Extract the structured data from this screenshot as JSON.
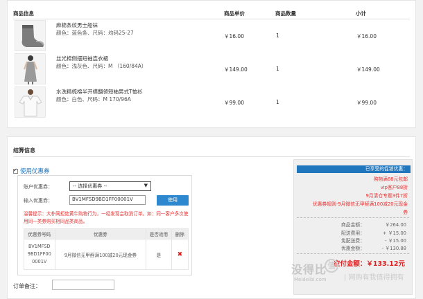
{
  "goods": {
    "headers": {
      "product": "商品信息",
      "price": "商品单价",
      "qty": "商品数量",
      "subtotal": "小计"
    },
    "items": [
      {
        "name": "麻棉条纹男士船袜",
        "attrs": "颜色：蓝色条、尺码：均码25-27",
        "price": "￥16.00",
        "qty": "1",
        "subtotal": "￥16.00",
        "image": "socks-image"
      },
      {
        "name": "丝光棉侧摆短袖连衣裙",
        "attrs": "颜色：浅灰色、尺码：M （160/84A）",
        "price": "￥149.00",
        "qty": "1",
        "subtotal": "￥149.00",
        "image": "dress-image"
      },
      {
        "name": "水洗精梳棉半开襟翻领短袖男式T恤衫",
        "attrs": "颜色：白色、尺码：M 170/96A",
        "price": "￥99.00",
        "qty": "1",
        "subtotal": "￥99.00",
        "image": "tshirt-image"
      }
    ]
  },
  "settle": {
    "title": "结算信息",
    "use_coupon": "使用优惠券",
    "account_coupon_label": "账户优惠券：",
    "account_coupon_value": "-- 选择优惠券 --",
    "input_coupon_label": "输入优惠券：",
    "input_coupon_value": "BV1MFSD9BD1FF00001V",
    "use_button": "使用",
    "tip": "温馨提示：大朴网拒绝黄牛购物行为，一经发现会取消订单。如：同一客户多次使用同一类券购买相同品类商品。",
    "table_headers": {
      "code": "优惠券号码",
      "coupon": "优惠券",
      "applied": "是否适用",
      "delete": "删除"
    },
    "row": {
      "code_lines": [
        "BV1MFSD",
        "9BD1FF00",
        "0001V"
      ],
      "coupon": "9月微信无甲醛满100减20元现金券",
      "applied": "是"
    },
    "remark_label": "订单备注："
  },
  "summary": {
    "promo_header": "已享受的促销优惠：",
    "promos": [
      "购物满88元包邮",
      "vip客户88折",
      "9月清仓专题3件7折",
      "优惠券规则-9月微信无甲醛满100减20元现金",
      "券"
    ],
    "rows": [
      {
        "label": "商品金额：",
        "value": "￥264.00"
      },
      {
        "label": "配送费用：",
        "value": "+ ￥15.00"
      },
      {
        "label": "免配送费：",
        "value": "- ￥15.00"
      },
      {
        "label": "优惠金额：",
        "value": "- ￥130.88"
      }
    ],
    "total_label": "应付金额：",
    "total_value": "￥133.12元"
  },
  "watermark": {
    "logo_char": "值",
    "text": "没得比",
    "sub": "Meideibi.com",
    "slogan": "| 网购有我值得拥有"
  },
  "colors": {
    "accent": "#1f76bd",
    "alert": "#e63030",
    "button": "#2e88cf"
  }
}
